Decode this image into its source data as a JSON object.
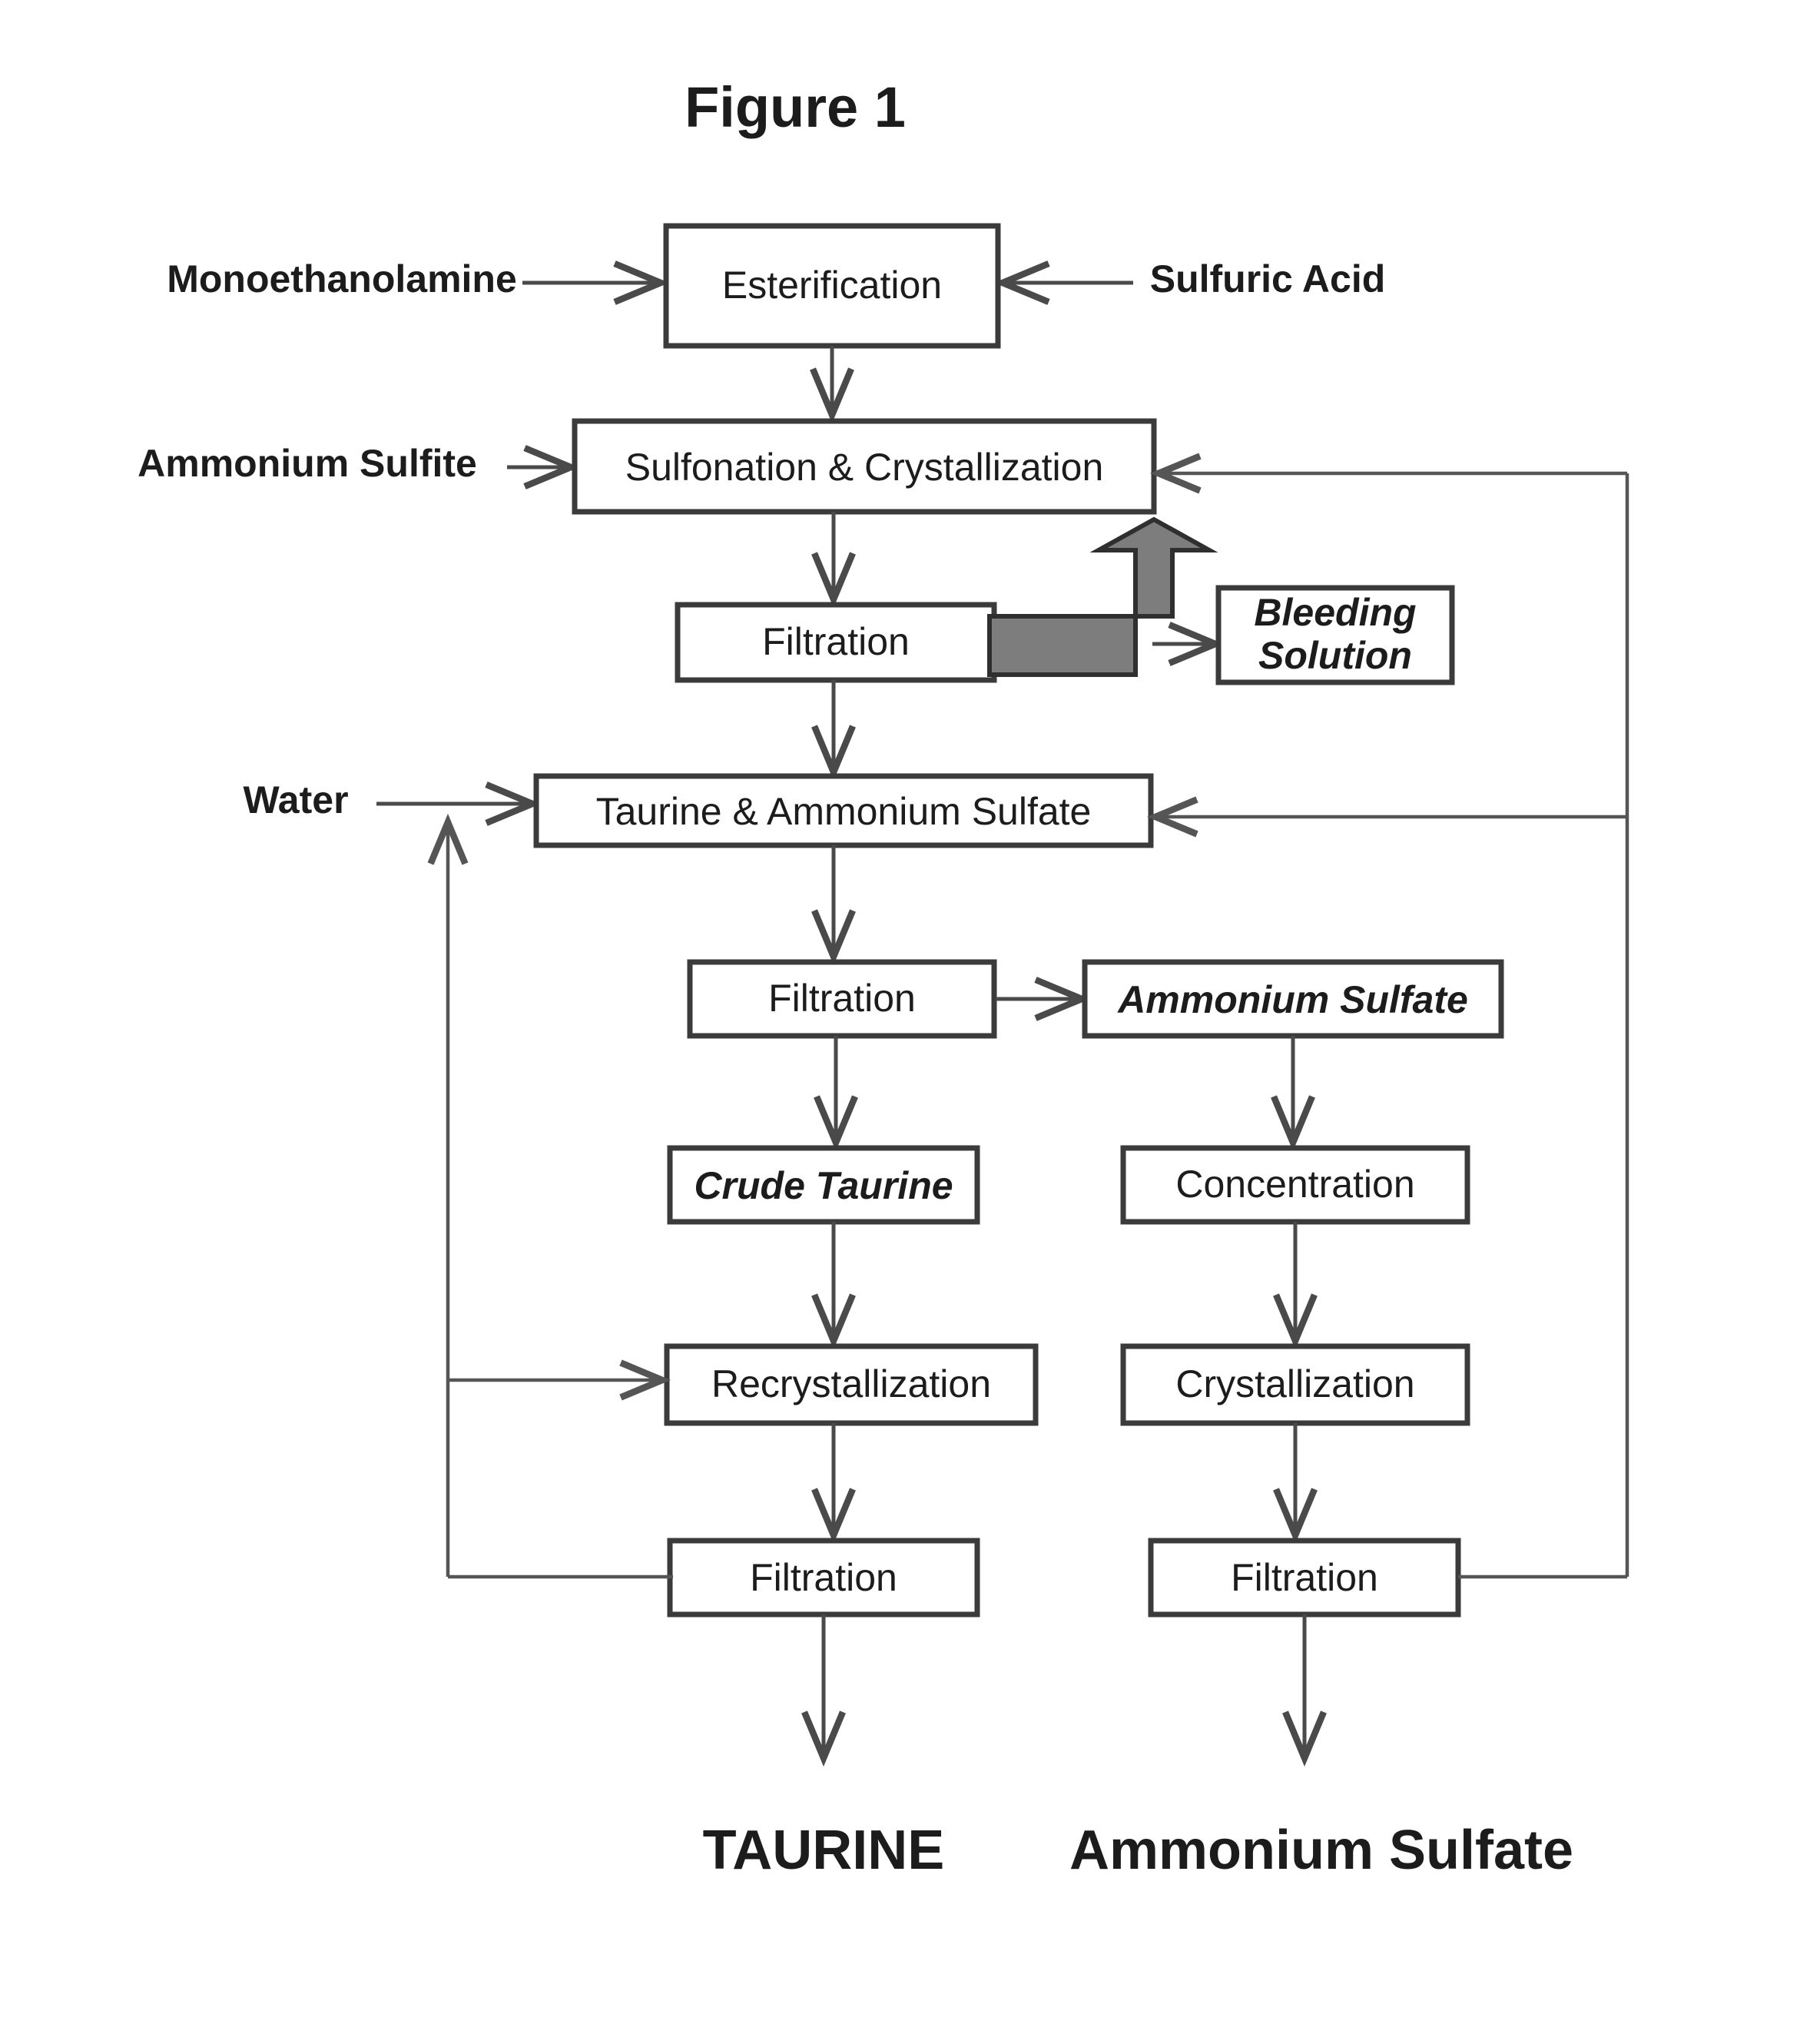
{
  "figure": {
    "title": "Figure 1",
    "background_color": "#ffffff",
    "line_color": "#4a4a4a",
    "box_border_color": "#3b3b3b",
    "gray_arrow_color": "#7d7d7d",
    "text_color": "#1c1c1c"
  },
  "inputs": [
    {
      "id": "monoethanolamine",
      "label": "Monoethanolamine"
    },
    {
      "id": "sulfuric-acid",
      "label": "Sulfuric Acid"
    },
    {
      "id": "ammonium-sulfite",
      "label": "Ammonium Sulfite"
    },
    {
      "id": "water",
      "label": "Water"
    }
  ],
  "nodes": [
    {
      "id": "esterification",
      "label": "Esterification",
      "style": "plain"
    },
    {
      "id": "sulfonation-crystallization",
      "label": "Sulfonation & Crystallization",
      "style": "plain"
    },
    {
      "id": "filtration-1",
      "label": "Filtration",
      "style": "plain"
    },
    {
      "id": "bleeding-solution",
      "label": "Bleeding\nSolution",
      "line1": "Bleeding",
      "line2": "Solution",
      "style": "bold-italic"
    },
    {
      "id": "taurine-ammonium-sulfate",
      "label": "Taurine & Ammonium  Sulfate",
      "style": "plain"
    },
    {
      "id": "filtration-2",
      "label": "Filtration",
      "style": "plain"
    },
    {
      "id": "ammonium-sulfate-stream",
      "label": "Ammonium Sulfate",
      "style": "bold-italic"
    },
    {
      "id": "crude-taurine",
      "label": "Crude Taurine",
      "style": "bold-italic"
    },
    {
      "id": "concentration",
      "label": "Concentration",
      "style": "plain"
    },
    {
      "id": "recrystallization",
      "label": "Recrystallization",
      "style": "plain"
    },
    {
      "id": "crystallization",
      "label": "Crystallization",
      "style": "plain"
    },
    {
      "id": "filtration-3",
      "label": "Filtration",
      "style": "plain"
    },
    {
      "id": "filtration-4",
      "label": "Filtration",
      "style": "plain"
    }
  ],
  "products": [
    {
      "id": "taurine-product",
      "label": "TAURINE"
    },
    {
      "id": "ammonium-sulfate-product",
      "label": "Ammonium Sulfate"
    }
  ],
  "chart_data": {
    "type": "diagram",
    "title": "Figure 1",
    "diagram_kind": "process-flow-chart",
    "nodes": [
      "Esterification",
      "Sulfonation & Crystallization",
      "Filtration",
      "Bleeding Solution",
      "Taurine & Ammonium  Sulfate",
      "Filtration",
      "Ammonium Sulfate",
      "Crude Taurine",
      "Concentration",
      "Recrystallization",
      "Crystallization",
      "Filtration",
      "Filtration",
      "TAURINE",
      "Ammonium Sulfate"
    ],
    "edges": [
      {
        "from": "Monoethanolamine",
        "to": "Esterification"
      },
      {
        "from": "Sulfuric Acid",
        "to": "Esterification"
      },
      {
        "from": "Esterification",
        "to": "Sulfonation & Crystallization"
      },
      {
        "from": "Ammonium Sulfite",
        "to": "Sulfonation & Crystallization"
      },
      {
        "from": "Sulfonation & Crystallization",
        "to": "Filtration"
      },
      {
        "from": "Filtration",
        "to": "Bleeding Solution",
        "style": "gray-elbow-arrow"
      },
      {
        "from": "Filtration",
        "to": "Taurine & Ammonium  Sulfate"
      },
      {
        "from": "Water",
        "to": "Taurine & Ammonium  Sulfate"
      },
      {
        "from": "Taurine & Ammonium  Sulfate",
        "to": "Filtration"
      },
      {
        "from": "Filtration",
        "to": "Ammonium Sulfate"
      },
      {
        "from": "Filtration",
        "to": "Crude Taurine"
      },
      {
        "from": "Ammonium Sulfate",
        "to": "Concentration"
      },
      {
        "from": "Crude Taurine",
        "to": "Recrystallization"
      },
      {
        "from": "Concentration",
        "to": "Crystallization"
      },
      {
        "from": "Recrystallization",
        "to": "Filtration"
      },
      {
        "from": "Crystallization",
        "to": "Filtration"
      },
      {
        "from": "Filtration",
        "to": "TAURINE"
      },
      {
        "from": "Filtration",
        "to": "Ammonium Sulfate"
      },
      {
        "from": "Filtration (taurine)",
        "to": "Taurine & Ammonium  Sulfate",
        "style": "recycle-left"
      },
      {
        "from": "Filtration (ammonium sulfate)",
        "to": "Sulfonation & Crystallization",
        "style": "recycle-right"
      },
      {
        "from": "Filtration (ammonium sulfate)",
        "to": "Taurine & Ammonium  Sulfate",
        "style": "recycle-right-branch"
      }
    ]
  }
}
